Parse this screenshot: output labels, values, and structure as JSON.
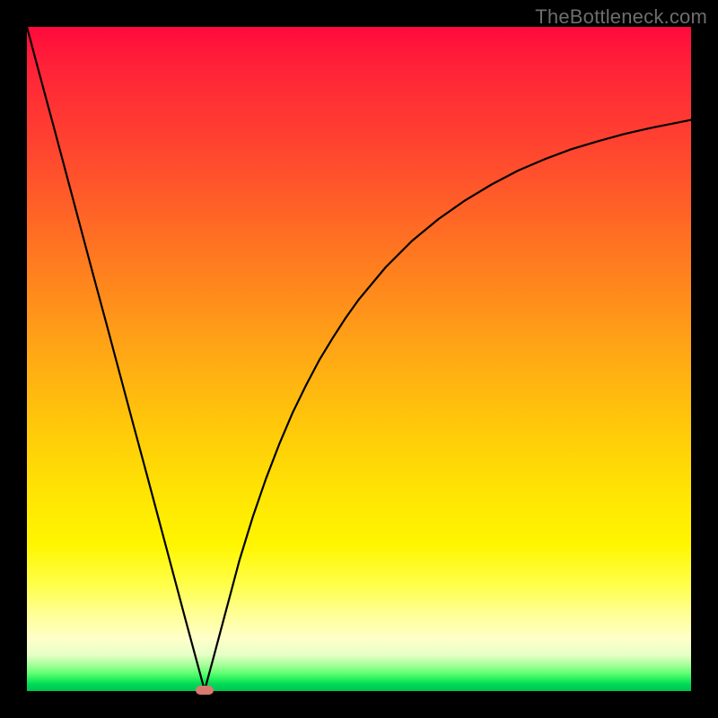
{
  "watermark": "TheBottleneck.com",
  "colors": {
    "frame": "#000000",
    "curve_stroke": "#000000",
    "marker_fill": "#d97a6f",
    "watermark_text": "#6d6d6d"
  },
  "chart_data": {
    "type": "line",
    "title": "",
    "xlabel": "",
    "ylabel": "",
    "x": [
      0.0,
      0.02,
      0.04,
      0.06,
      0.08,
      0.1,
      0.12,
      0.14,
      0.16,
      0.18,
      0.2,
      0.22,
      0.24,
      0.26,
      0.2675,
      0.28,
      0.3,
      0.32,
      0.34,
      0.36,
      0.38,
      0.4,
      0.42,
      0.44,
      0.46,
      0.48,
      0.5,
      0.54,
      0.58,
      0.62,
      0.66,
      0.7,
      0.74,
      0.78,
      0.82,
      0.86,
      0.9,
      0.94,
      0.98,
      1.0
    ],
    "y": [
      1.0,
      0.925,
      0.851,
      0.776,
      0.701,
      0.626,
      0.552,
      0.477,
      0.402,
      0.328,
      0.253,
      0.178,
      0.103,
      0.029,
      0.001,
      0.047,
      0.122,
      0.197,
      0.262,
      0.32,
      0.372,
      0.419,
      0.46,
      0.498,
      0.531,
      0.562,
      0.59,
      0.638,
      0.678,
      0.711,
      0.739,
      0.763,
      0.784,
      0.801,
      0.816,
      0.828,
      0.839,
      0.848,
      0.856,
      0.86
    ],
    "xlim": [
      0,
      1
    ],
    "ylim": [
      0,
      1
    ],
    "marker": {
      "x": 0.2675,
      "y": 0.002
    },
    "grid": false,
    "legend": false,
    "notes": "x and y are normalized to the plot area (0..1). y=0 is the bottom (green) edge, y=1 is the top (red) edge. The curve is a V / asymmetric cusp reaching its minimum near x≈0.27."
  }
}
